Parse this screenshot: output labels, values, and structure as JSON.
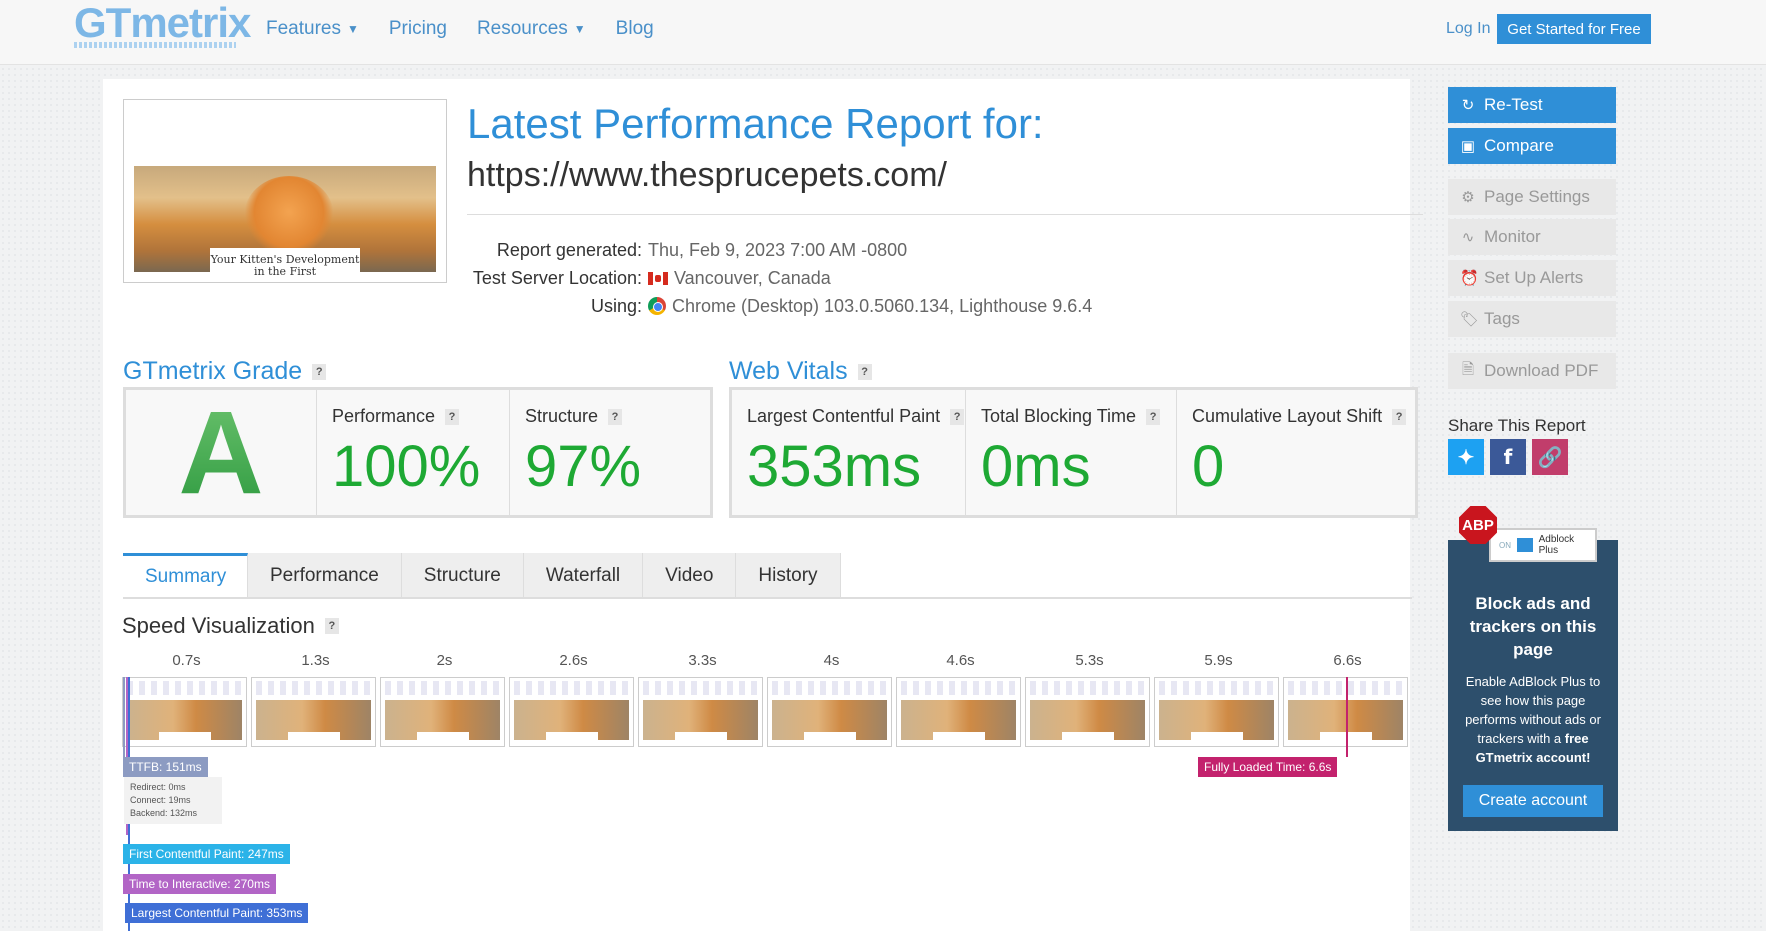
{
  "header": {
    "logo": "GTmetrix",
    "nav": [
      {
        "label": "Features",
        "dropdown": true
      },
      {
        "label": "Pricing",
        "dropdown": false
      },
      {
        "label": "Resources",
        "dropdown": true
      },
      {
        "label": "Blog",
        "dropdown": false
      }
    ],
    "login": "Log In",
    "cta": "Get Started for Free"
  },
  "report": {
    "title": "Latest Performance Report for:",
    "url": "https://www.thesprucepets.com/",
    "meta": [
      {
        "label": "Report generated:",
        "value": "Thu, Feb 9, 2023 7:00 AM -0800",
        "icon": ""
      },
      {
        "label": "Test Server Location:",
        "value": "Vancouver, Canada",
        "icon": "canada-flag-icon"
      },
      {
        "label": "Using:",
        "value": "Chrome (Desktop) 103.0.5060.134, Lighthouse 9.6.4",
        "icon": "chrome-icon"
      }
    ],
    "thumb_caption": "Your Kitten's Development in the First"
  },
  "grade": {
    "title": "GTmetrix Grade",
    "letter": "A",
    "performance_label": "Performance",
    "performance_value": "100%",
    "structure_label": "Structure",
    "structure_value": "97%"
  },
  "vitals": {
    "title": "Web Vitals",
    "lcp_label": "Largest Contentful Paint",
    "lcp_value": "353ms",
    "tbt_label": "Total Blocking Time",
    "tbt_value": "0ms",
    "cls_label": "Cumulative Layout Shift",
    "cls_value": "0"
  },
  "tabs": [
    "Summary",
    "Performance",
    "Structure",
    "Waterfall",
    "Video",
    "History"
  ],
  "speed": {
    "title": "Speed Visualization",
    "frames": [
      "0.7s",
      "1.3s",
      "2s",
      "2.6s",
      "3.3s",
      "4s",
      "4.6s",
      "5.3s",
      "5.9s",
      "6.6s"
    ],
    "ttfb": "TTFB: 151ms",
    "ttfb_details": [
      "Redirect: 0ms",
      "Connect: 19ms",
      "Backend: 132ms"
    ],
    "fully_loaded": "Fully Loaded Time: 6.6s",
    "fcp": "First Contentful Paint: 247ms",
    "tti": "Time to Interactive: 270ms",
    "lcp": "Largest Contentful Paint: 353ms"
  },
  "sidebar": {
    "retest": "Re-Test",
    "compare": "Compare",
    "page_settings": "Page Settings",
    "monitor": "Monitor",
    "alerts": "Set Up Alerts",
    "tags": "Tags",
    "download": "Download PDF",
    "share_title": "Share This Report"
  },
  "adblock": {
    "badge": "ABP",
    "toggle_on": "ON",
    "toggle_label": "Adblock Plus",
    "headline": "Block ads and trackers on this page",
    "body_pre": "Enable AdBlock Plus to see how this page performs without ads or trackers with a ",
    "body_bold": "free GTmetrix account!",
    "button": "Create account"
  },
  "colors": {
    "accent": "#2f8fd7",
    "grade_green": "#1ea934",
    "ttfb": "#8c9bc2",
    "fcp": "#2bb3e8",
    "tti": "#b265c6",
    "lcp": "#3f6fd6",
    "fully_loaded": "#c3226d"
  }
}
